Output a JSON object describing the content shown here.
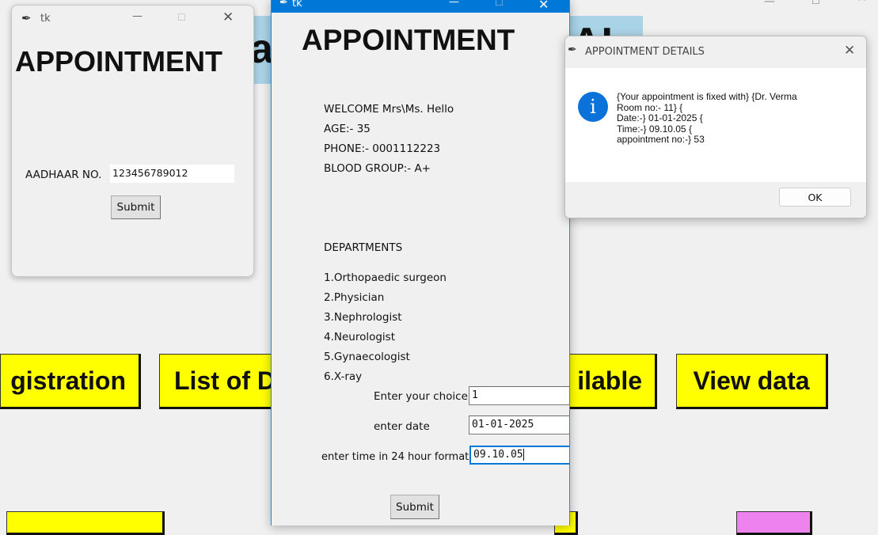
{
  "background_window": {
    "controls": {
      "minimize": "—",
      "maximize": "☐",
      "close": "^"
    },
    "title_fragment_left": "a",
    "title_fragment_right": "AL",
    "buttons_row1": [
      {
        "label": "gistration"
      },
      {
        "label": "List of D"
      },
      {
        "label": "ilable"
      },
      {
        "label": "View data"
      }
    ],
    "colors": {
      "button": "#ffff00",
      "pink_button": "#ee82ee",
      "title_band": "#a9d3e6"
    }
  },
  "window1": {
    "title": "tk",
    "heading": "APPOINTMENT",
    "aadhaar_label": "AADHAAR NO.",
    "aadhaar_value": "123456789012",
    "submit_label": "Submit"
  },
  "window2": {
    "title": "tk",
    "heading": "APPOINTMENT",
    "welcome": "WELCOME    Mrs\\Ms.  Hello",
    "age": "AGE:-     35",
    "phone": "PHONE:- 0001112223",
    "blood_group": "BLOOD GROUP:-    A+",
    "departments_heading": "DEPARTMENTS",
    "departments": [
      "1.Orthopaedic surgeon",
      "2.Physician",
      "3.Nephrologist",
      "4.Neurologist",
      "5.Gynaecologist",
      "6.X-ray"
    ],
    "choice_label": "Enter your choice",
    "choice_value": "1",
    "date_label": "enter date",
    "date_value": "01-01-2025",
    "time_label": "enter time in 24 hour format",
    "time_value": "09.10.05",
    "submit_label": "Submit",
    "titlebar_color": "#0078d7"
  },
  "dialog": {
    "title": "APPOINTMENT DETAILS",
    "icon": "info-icon",
    "message": "{Your appointment is fixed with} {Dr. Verma\nRoom no:- 11} {\nDate:-} 01-01-2025 {\nTime:-} 09.10.05 {\nappointment no:-} 53",
    "ok_label": "OK",
    "icon_color": "#0b72d9"
  }
}
